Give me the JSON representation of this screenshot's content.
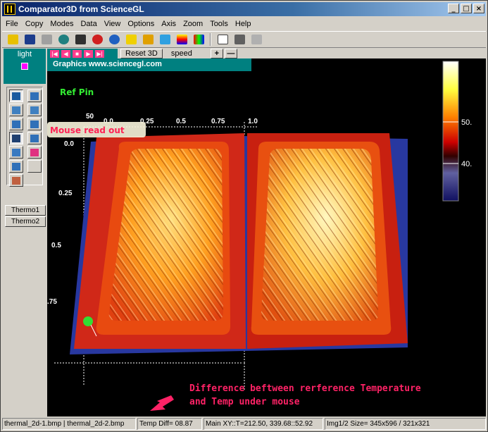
{
  "window": {
    "title": "Comparator3D from ScienceGL",
    "min": "_",
    "max": "□",
    "close": "×"
  },
  "menu": [
    "File",
    "Copy",
    "Modes",
    "Data",
    "View",
    "Options",
    "Axis",
    "Zoom",
    "Tools",
    "Help"
  ],
  "left_panel": {
    "light_label": "light",
    "thermo1": "Thermo1",
    "thermo2": "Thermo2"
  },
  "controls": {
    "reset": "Reset 3D",
    "speed": "speed",
    "plus": "+",
    "minus": "—"
  },
  "graphics": {
    "title": "Graphics www.sciencegl.com",
    "x_ticks": [
      "0.0",
      "0.25",
      "0.5",
      "0.75",
      "1.0"
    ],
    "y_ticks": [
      "0.0",
      "0.25",
      "0.5",
      ".75"
    ],
    "corner_tick": "50",
    "colorbar_labels": [
      "50.",
      "40."
    ]
  },
  "annotations": {
    "ref_pin": "Ref Pin",
    "mouse_readout": "Mouse read out",
    "difference_line1": "Difference beftween rerference Temperature",
    "difference_line2": "and Temp under mouse"
  },
  "status": {
    "files": "thermal_2d-1.bmp | thermal_2d-2.bmp",
    "temp_diff": "Temp Diff= 08.87",
    "main_xy": "Main XY::T=212.50, 339.68::52.92",
    "img_size": "Img1/2 Size= 345x596 / 321x321"
  },
  "colors": {
    "accent": "#008080",
    "annotation_green": "#33ff33",
    "annotation_pink": "#ff2266"
  }
}
